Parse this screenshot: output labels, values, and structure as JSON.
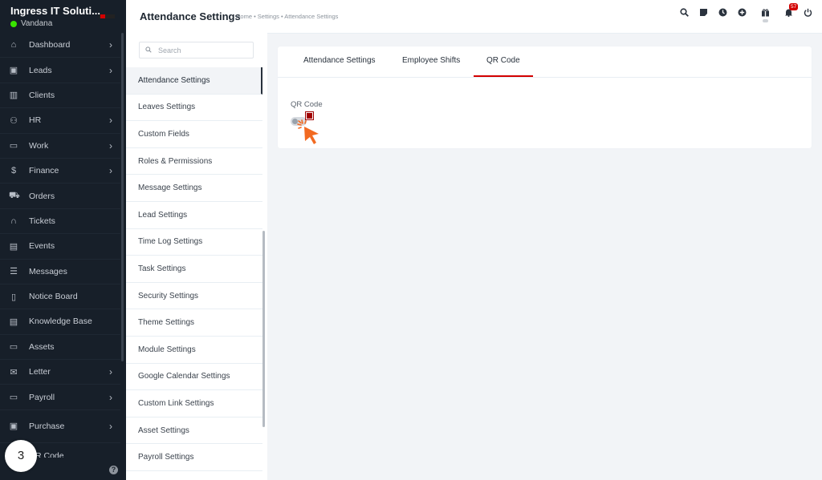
{
  "brand": {
    "name": "Ingress IT Soluti...",
    "user": "Vandana"
  },
  "sidebar": {
    "items": [
      {
        "label": "Dashboard",
        "icon": "home-icon",
        "chevron": true
      },
      {
        "label": "Leads",
        "icon": "contact-card-icon",
        "chevron": true
      },
      {
        "label": "Clients",
        "icon": "building-icon",
        "chevron": false
      },
      {
        "label": "HR",
        "icon": "people-icon",
        "chevron": true
      },
      {
        "label": "Work",
        "icon": "briefcase-icon",
        "chevron": true
      },
      {
        "label": "Finance",
        "icon": "dollar-icon",
        "chevron": true
      },
      {
        "label": "Orders",
        "icon": "cart-icon",
        "chevron": false
      },
      {
        "label": "Tickets",
        "icon": "headset-icon",
        "chevron": false
      },
      {
        "label": "Events",
        "icon": "calendar-icon",
        "chevron": false
      },
      {
        "label": "Messages",
        "icon": "chat-icon",
        "chevron": false
      },
      {
        "label": "Notice Board",
        "icon": "clipboard-icon",
        "chevron": false
      },
      {
        "label": "Knowledge Base",
        "icon": "document-icon",
        "chevron": false
      },
      {
        "label": "Assets",
        "icon": "monitor-icon",
        "chevron": false
      },
      {
        "label": "Letter",
        "icon": "envelope-icon",
        "chevron": true
      },
      {
        "label": "Payroll",
        "icon": "wallet-icon",
        "chevron": true
      },
      {
        "label": "Purchase",
        "icon": "box-icon",
        "chevron": true
      }
    ],
    "partial_item": "R Code",
    "step_number": "3"
  },
  "topbar": {
    "title": "Attendance Settings",
    "breadcrumb": "Home • Settings • Attendance Settings",
    "notification_count": "57"
  },
  "settings_menu": {
    "search_placeholder": "Search",
    "items": [
      "Attendance Settings",
      "Leaves Settings",
      "Custom Fields",
      "Roles & Permissions",
      "Message Settings",
      "Lead Settings",
      "Time Log Settings",
      "Task Settings",
      "Security Settings",
      "Theme Settings",
      "Module Settings",
      "Google Calendar Settings",
      "Custom Link Settings",
      "Asset Settings",
      "Payroll Settings"
    ],
    "active_index": 0
  },
  "panel": {
    "tabs": [
      "Attendance Settings",
      "Employee Shifts",
      "QR Code"
    ],
    "active_tab": 2,
    "field_label": "QR Code",
    "toggle_on": false
  },
  "colors": {
    "accent": "#d30000",
    "sidebar_bg": "#171f29",
    "cursor": "#f26a21"
  }
}
